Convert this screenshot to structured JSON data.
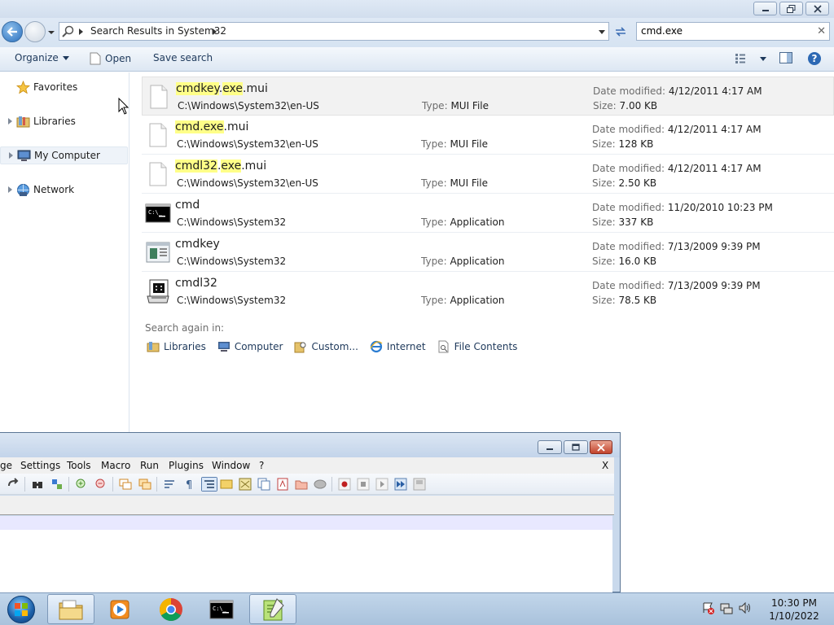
{
  "explorer": {
    "address": {
      "location": "Search Results in System32"
    },
    "search": {
      "value": "cmd.exe"
    },
    "commands": {
      "organize": "Organize",
      "open": "Open",
      "save_search": "Save search"
    },
    "nav": [
      {
        "label": "Favorites",
        "icon": "star-icon"
      },
      {
        "label": "Libraries",
        "icon": "libraries-icon"
      },
      {
        "label": "My Computer",
        "icon": "computer-icon"
      },
      {
        "label": "Network",
        "icon": "network-icon"
      }
    ],
    "labels": {
      "date_modified": "Date modified:",
      "size": "Size:",
      "type": "Type:"
    },
    "results": [
      {
        "name_parts": [
          "cmdkey",
          ".",
          "exe",
          ".mui"
        ],
        "path": "C:\\Windows\\System32\\en-US",
        "type": "MUI File",
        "date": "4/12/2011 4:17 AM",
        "size": "7.00 KB",
        "icon": "blank-file-icon"
      },
      {
        "name_parts": [
          "cmd.exe",
          ".mui"
        ],
        "path": "C:\\Windows\\System32\\en-US",
        "type": "MUI File",
        "date": "4/12/2011 4:17 AM",
        "size": "128 KB",
        "icon": "blank-file-icon"
      },
      {
        "name_parts": [
          "cmdl32",
          ".",
          "exe",
          ".mui"
        ],
        "path": "C:\\Windows\\System32\\en-US",
        "type": "MUI File",
        "date": "4/12/2011 4:17 AM",
        "size": "2.50 KB",
        "icon": "blank-file-icon"
      },
      {
        "name_parts": [
          "cmd"
        ],
        "path": "C:\\Windows\\System32",
        "type": "Application",
        "date": "11/20/2010 10:23 PM",
        "size": "337 KB",
        "icon": "console-icon"
      },
      {
        "name_parts": [
          "cmdkey"
        ],
        "path": "C:\\Windows\\System32",
        "type": "Application",
        "date": "7/13/2009 9:39 PM",
        "size": "16.0 KB",
        "icon": "cmdkey-app-icon"
      },
      {
        "name_parts": [
          "cmdl32"
        ],
        "path": "C:\\Windows\\System32",
        "type": "Application",
        "date": "7/13/2009 9:39 PM",
        "size": "78.5 KB",
        "icon": "phone-app-icon"
      }
    ],
    "search_again": {
      "label": "Search again in:",
      "items": [
        "Libraries",
        "Computer",
        "Custom...",
        "Internet",
        "File Contents"
      ]
    }
  },
  "notepadpp": {
    "menu": [
      "ge",
      "Settings",
      "Tools",
      "Macro",
      "Run",
      "Plugins",
      "Window",
      "?"
    ],
    "close_doc": "X"
  },
  "taskbar": {
    "clock_time": "10:30 PM",
    "clock_date": "1/10/2022"
  },
  "colors": {
    "highlight": "#ffff88",
    "accent": "#1e395b",
    "selection": "#eef3f9"
  }
}
